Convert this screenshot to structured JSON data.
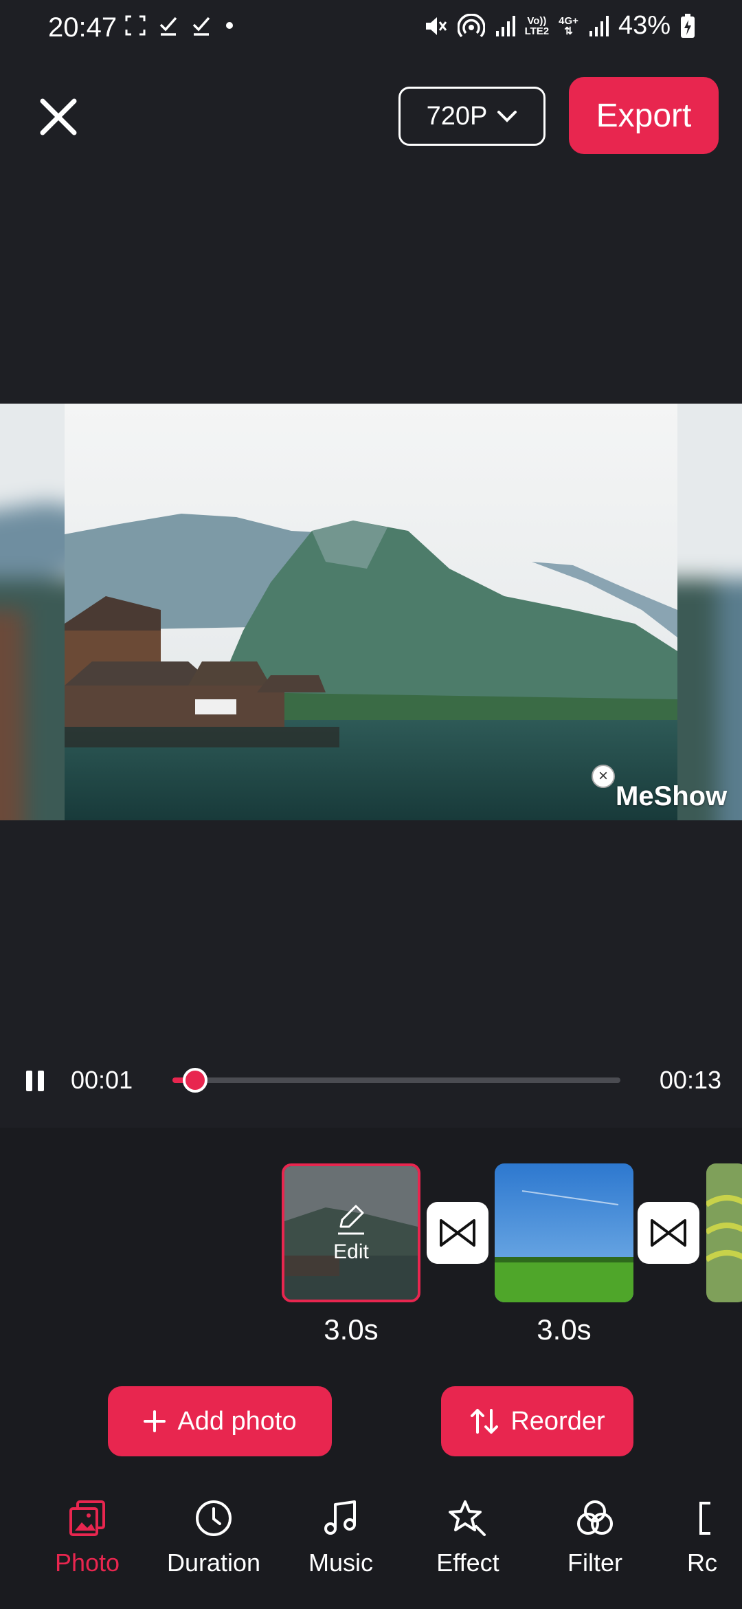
{
  "status_bar": {
    "time": "20:47",
    "battery": "43%",
    "net_top": "Vo))",
    "net_bottom": "LTE2",
    "net_4g": "4G+"
  },
  "top_bar": {
    "resolution": "720P",
    "export_label": "Export"
  },
  "preview": {
    "watermark": "MeShow"
  },
  "playback": {
    "current_time": "00:01",
    "total_time": "00:13",
    "progress": 0.05
  },
  "timeline": {
    "clips": [
      {
        "duration": "3.0s",
        "edit_label": "Edit",
        "selected": true
      },
      {
        "duration": "3.0s"
      }
    ]
  },
  "actions": {
    "add_photo": "Add photo",
    "reorder": "Reorder"
  },
  "nav": {
    "items": [
      {
        "label": "Photo",
        "icon": "photo-icon",
        "active": true
      },
      {
        "label": "Duration",
        "icon": "clock-icon"
      },
      {
        "label": "Music",
        "icon": "music-note-icon"
      },
      {
        "label": "Effect",
        "icon": "star-effect-icon"
      },
      {
        "label": "Filter",
        "icon": "filter-icon"
      },
      {
        "label": "Rc",
        "icon": "ratio-icon"
      }
    ]
  },
  "colors": {
    "accent": "#e8264f",
    "background": "#1e1f24"
  }
}
